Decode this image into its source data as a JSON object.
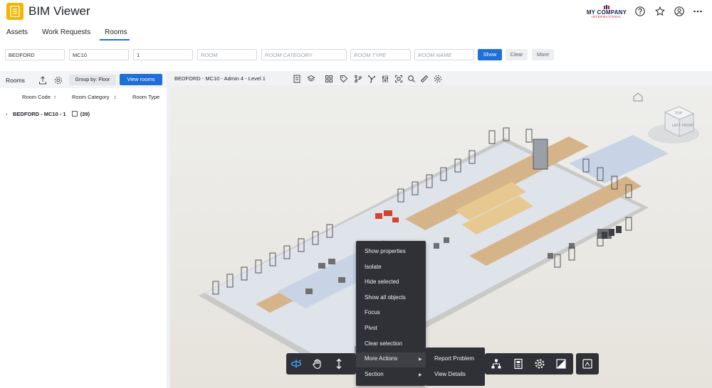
{
  "header": {
    "app_title": "BIM Viewer",
    "brand_name": "MY COMPANY",
    "brand_sub": "INTERNATIONAL"
  },
  "tabs": [
    {
      "label": "Assets",
      "active": false
    },
    {
      "label": "Work Requests",
      "active": false
    },
    {
      "label": "Rooms",
      "active": true
    }
  ],
  "filters": {
    "site": "BEDFORD",
    "building": "MC10",
    "floor": "1",
    "room_placeholder": "ROOM",
    "room_category_placeholder": "ROOM CATEGORY",
    "room_type_placeholder": "ROOM TYPE",
    "room_name_placeholder": "ROOM NAME",
    "show_label": "Show",
    "clear_label": "Clear",
    "more_label": "More"
  },
  "left_panel": {
    "title": "Rooms",
    "group_by_label": "Group by: Floor",
    "view_rooms_label": "View rooms",
    "columns": [
      "Room Code",
      "Room Category",
      "Room Type"
    ],
    "tree_row_label": "BEDFORD - MC10 - 1",
    "tree_row_count": "(39)"
  },
  "viewer": {
    "title": "BEDFORD - MC10 - Admin 4 - Level 1"
  },
  "context_menu": {
    "items": [
      {
        "label": "Show properties"
      },
      {
        "label": "Isolate"
      },
      {
        "label": "Hide selected"
      },
      {
        "label": "Show all objects"
      },
      {
        "label": "Focus"
      },
      {
        "label": "Pivot"
      },
      {
        "label": "Clear selection"
      },
      {
        "label": "More Actions",
        "has_submenu": true
      },
      {
        "label": "Section",
        "has_submenu": true
      }
    ],
    "submenu": [
      {
        "label": "Report Problem"
      },
      {
        "label": "View Details"
      }
    ]
  },
  "viewcube": {
    "left_face": "LEFT",
    "front_face": "FRONT",
    "top_face": "TOP"
  },
  "colors": {
    "accent": "#1f6fd6",
    "logo": "#f5b400",
    "menu_bg": "#2f3136"
  }
}
